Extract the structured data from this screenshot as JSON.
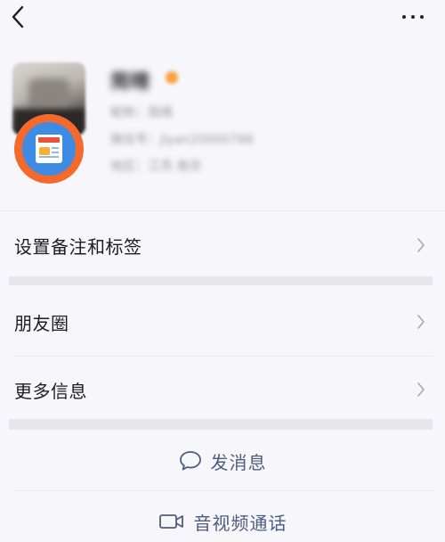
{
  "header": {
    "back_icon": "chevron-left-icon",
    "more_icon": "more-dots-icon"
  },
  "profile": {
    "name": "简晴",
    "line1": "昵称：简晴",
    "line2": "微信号：Jiyan20000786",
    "line3": "地区：江苏 南京",
    "badge_icon": "news-app-icon"
  },
  "menu": {
    "remark_tags": "设置备注和标签",
    "moments": "朋友圈",
    "more_info": "更多信息"
  },
  "actions": {
    "send_message": "发消息",
    "video_call": "音视频通话"
  },
  "colors": {
    "badge_orange": "#f36a2c",
    "badge_blue": "#3d8be3",
    "action_text": "#4e5c80"
  }
}
